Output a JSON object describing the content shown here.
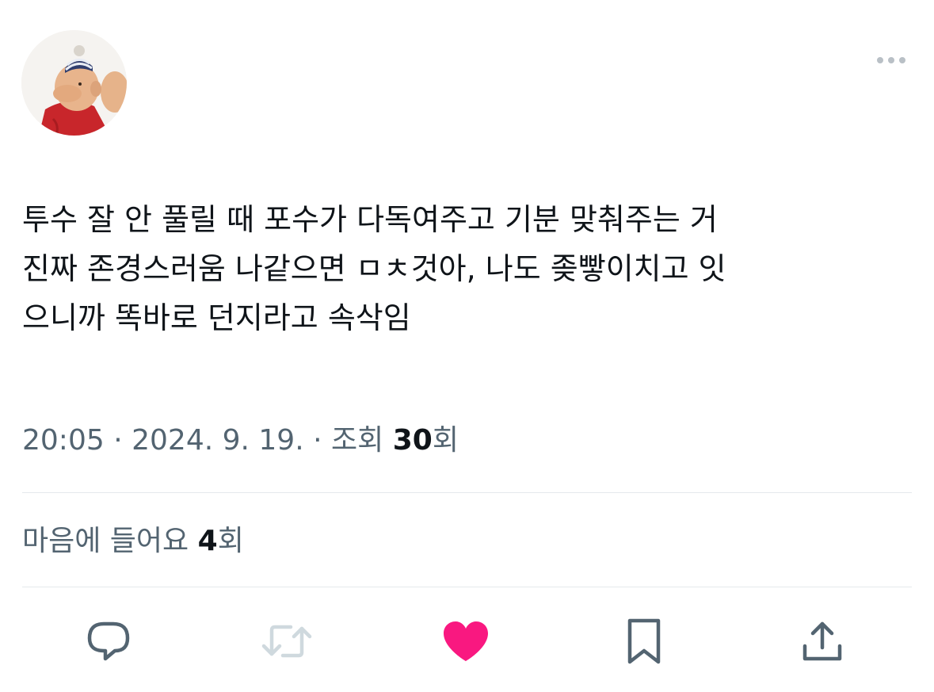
{
  "tweet": {
    "text_lines": [
      "투수 잘 안 풀릴 때 포수가 다독여주고 기분 맞춰주는 거",
      "진짜 존경스러움 나같으면 ㅁㅊ것아, 나도 좆빻이치고 잇",
      "으니까 똑바로 던지라고 속삭임"
    ]
  },
  "meta": {
    "time": "20:05",
    "separator": "·",
    "date": "2024. 9. 19.",
    "views_label": "조회",
    "views_count": "30",
    "views_unit": "회"
  },
  "likes": {
    "label": "마음에 들어요",
    "count": "4",
    "unit": "회"
  },
  "actions": {
    "reply_icon": "reply-icon",
    "retweet_icon": "retweet-icon",
    "like_icon": "heart-icon",
    "bookmark_icon": "bookmark-icon",
    "share_icon": "share-icon"
  },
  "colors": {
    "text": "#0f1419",
    "secondary": "#536471",
    "divider": "#e5e9ec",
    "liked": "#f91880",
    "retweet_disabled": "#cfd9de",
    "icon": "#536471"
  }
}
